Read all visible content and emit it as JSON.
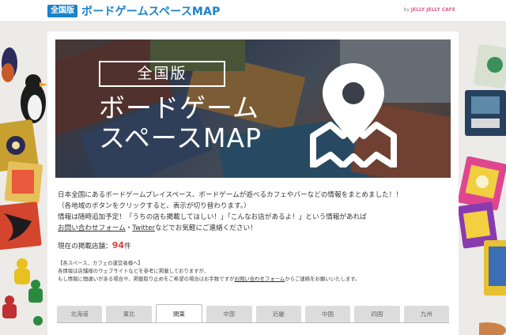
{
  "header": {
    "badge": "全国版",
    "title": "ボードゲームスペースMAP",
    "byline_prefix": "by",
    "byline_brand": "JELLY JELLY CAFE"
  },
  "hero": {
    "box_label": "全国版",
    "title_line1": "ボードゲーム",
    "title_line2": "スペースMAP",
    "icon": "map-pin-icon"
  },
  "intro": {
    "line1": "日本全国にあるボードゲームプレイスペース、ボードゲームが遊べるカフェやバーなどの情報をまとめました！！",
    "line2": "（各地域のボタンをクリックすると、表示が切り替わります。）",
    "line3": "情報は随時追加予定！「うちの店も掲載してほしい！」「こんなお店があるよ！」という情報があれば",
    "contact_link": "お問い合わせフォーム",
    "separator": "・",
    "twitter_link": "Twitter",
    "line4_suffix": "などでお気軽にご連絡ください！"
  },
  "count": {
    "label": "現在の掲載店舗：",
    "number": "94",
    "unit": "件"
  },
  "notice": {
    "heading": "【各スペース、カフェの運営者様へ】",
    "line1": "各情報は店舗様のウェブサイトなどを参考に掲載しておりますが、",
    "line2_prefix": "もし情報に間違いがある場合や、掲載取り止めをご希望の場合はお手数ですが",
    "line2_link": "お問い合わせフォーム",
    "line2_suffix": "からご連絡をお願いいたします。"
  },
  "tabs": [
    "北海道",
    "東北",
    "関東",
    "中部",
    "近畿",
    "中国",
    "四国",
    "九州"
  ],
  "active_tab": "関東",
  "colors": {
    "accent": "#1a83c9",
    "count_number": "#e13b3b"
  }
}
